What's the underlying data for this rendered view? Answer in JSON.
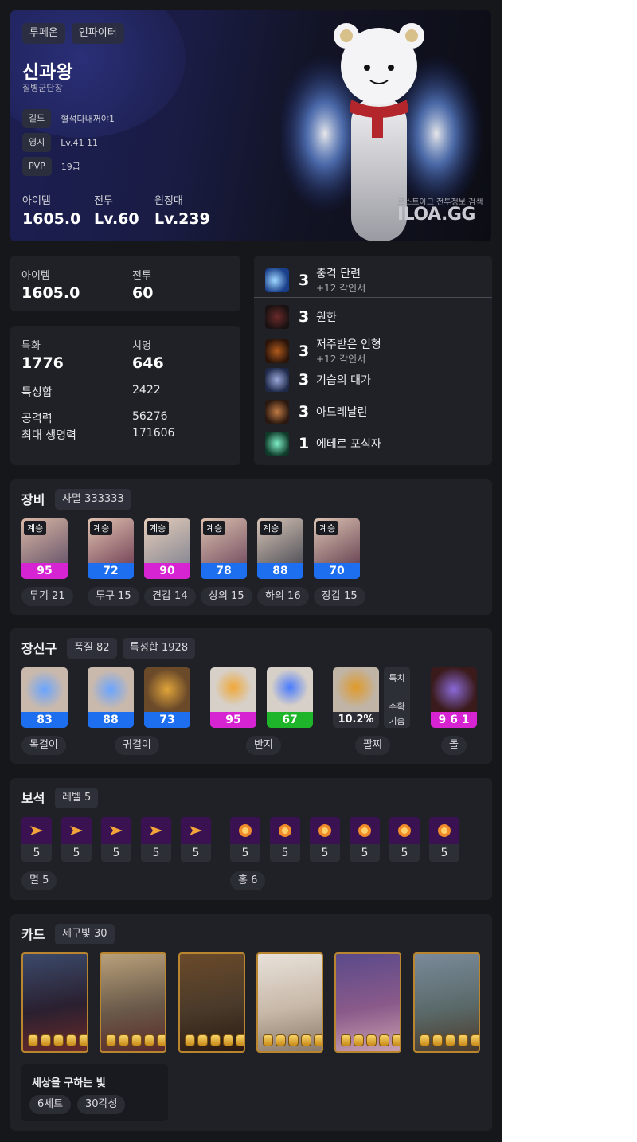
{
  "hero": {
    "server": "루페온",
    "class": "인파이터",
    "name": "신과왕",
    "title": "질병군단장",
    "guild_label": "길드",
    "guild_value": "혈석다내꺼야1",
    "estate_label": "영지",
    "estate_value": "Lv.41 11",
    "pvp_label": "PVP",
    "pvp_value": "19급",
    "stats": [
      {
        "label": "아이템",
        "value": "1605.0"
      },
      {
        "label": "전투",
        "value": "Lv.60"
      },
      {
        "label": "원정대",
        "value": "Lv.239"
      }
    ],
    "watermark_small": "로스트아크 전투정보 검색",
    "watermark_big": "ILOA.GG"
  },
  "level_box": {
    "item_label": "아이템",
    "item_value": "1605.0",
    "combat_label": "전투",
    "combat_value": "60"
  },
  "stats_box": {
    "spec_label": "특화",
    "spec_value": "1776",
    "crit_label": "치명",
    "crit_value": "646",
    "total_label": "특성합",
    "total_value": "2422",
    "atk_label": "공격력",
    "atk_value": "56276",
    "hp_label": "최대 생명력",
    "hp_value": "171606"
  },
  "engravings": [
    {
      "level": "3",
      "name": "충격 단련",
      "sub": "+12 각인서",
      "icon": "shock-training-icon"
    },
    {
      "level": "3",
      "name": "원한",
      "sub": "",
      "icon": "grudge-icon"
    },
    {
      "level": "3",
      "name": "저주받은 인형",
      "sub": "+12 각인서",
      "icon": "cursed-doll-icon"
    },
    {
      "level": "3",
      "name": "기습의 대가",
      "sub": "",
      "icon": "master-ambush-icon"
    },
    {
      "level": "3",
      "name": "아드레날린",
      "sub": "",
      "icon": "adrenaline-icon"
    },
    {
      "level": "1",
      "name": "에테르 포식자",
      "sub": "",
      "icon": "ether-predator-icon"
    }
  ],
  "equipment": {
    "title": "장비",
    "chip": "사멸 333333",
    "badge": "계승",
    "items": [
      {
        "quality": "95",
        "label": "무기 21",
        "color": "#d724d3"
      },
      {
        "quality": "72",
        "label": "투구 15",
        "color": "#1e6ff0"
      },
      {
        "quality": "90",
        "label": "견갑 14",
        "color": "#d724d3"
      },
      {
        "quality": "78",
        "label": "상의 15",
        "color": "#1e6ff0"
      },
      {
        "quality": "88",
        "label": "하의 16",
        "color": "#1e6ff0"
      },
      {
        "quality": "70",
        "label": "장갑 15",
        "color": "#1e6ff0"
      }
    ]
  },
  "accessories": {
    "title": "장신구",
    "chip1": "품질 82",
    "chip2": "특성합 1928",
    "qualities": [
      "83",
      "88",
      "73",
      "95",
      "67"
    ],
    "bracelet_value": "10.2%",
    "bracelet_opts": [
      "특치",
      "수확",
      "기습"
    ],
    "stone_value": "9 6 1",
    "labels": [
      "목걸이",
      "귀걸이",
      "반지",
      "팔찌",
      "돌"
    ]
  },
  "gems": {
    "title": "보석",
    "chip": "레벨 5",
    "left_values": [
      "5",
      "5",
      "5",
      "5",
      "5"
    ],
    "right_values": [
      "5",
      "5",
      "5",
      "5",
      "5",
      "5"
    ],
    "left_label": "멸 5",
    "right_label": "홍 6"
  },
  "cards": {
    "title": "카드",
    "chip": "세구빛 30",
    "set_name": "세상을 구하는 빛",
    "set_pill1": "6세트",
    "set_pill2": "30각성"
  }
}
